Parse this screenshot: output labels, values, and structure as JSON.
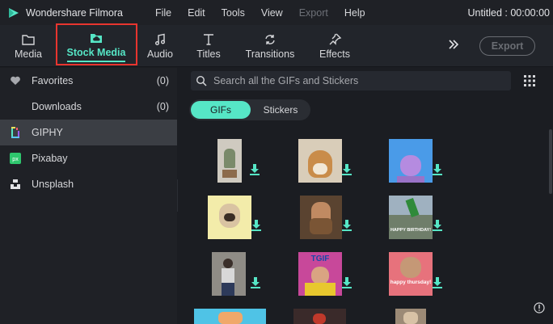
{
  "app": {
    "name": "Wondershare Filmora",
    "project_title": "Untitled : 00:00:00"
  },
  "menu": [
    "File",
    "Edit",
    "Tools",
    "View",
    "Export",
    "Help"
  ],
  "tabs": [
    {
      "label": "Media",
      "icon": "folder-icon"
    },
    {
      "label": "Stock Media",
      "icon": "cloud-folder-icon",
      "active": true
    },
    {
      "label": "Audio",
      "icon": "music-note-icon"
    },
    {
      "label": "Titles",
      "icon": "text-t-icon"
    },
    {
      "label": "Transitions",
      "icon": "transition-arrows-icon"
    },
    {
      "label": "Effects",
      "icon": "sparkle-pin-icon"
    }
  ],
  "toolbar": {
    "export_label": "Export"
  },
  "sidebar": {
    "favorites": {
      "label": "Favorites",
      "count": "(0)"
    },
    "downloads": {
      "label": "Downloads",
      "count": "(0)"
    },
    "giphy": {
      "label": "GIPHY"
    },
    "pixabay": {
      "label": "Pixabay"
    },
    "unsplash": {
      "label": "Unsplash"
    }
  },
  "search": {
    "placeholder": "Search all the GIFs and Stickers"
  },
  "segments": {
    "gifs": "GIFs",
    "stickers": "Stickers"
  },
  "thumb_captions": {
    "birthday": "HAPPY BIRTHDAY!",
    "thursday": "happy thursday!",
    "tgif": "TGIF"
  },
  "colors": {
    "accent": "#56e6c6",
    "highlight_box": "#e8352f",
    "bg": "#1b1d22"
  }
}
